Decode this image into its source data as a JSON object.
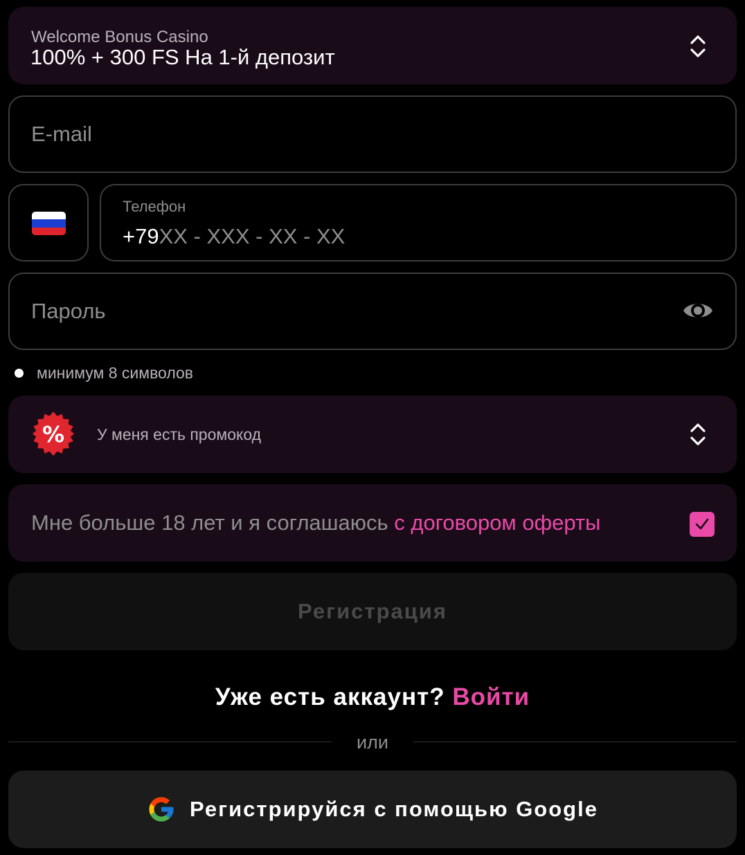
{
  "bonus": {
    "label": "Welcome Bonus Casino",
    "value": "100% + 300 FS На 1-й депозит"
  },
  "email": {
    "placeholder": "E-mail"
  },
  "phone": {
    "country_flag": "russia-flag",
    "flag_colors": [
      "#ffffff",
      "#1c3fd1",
      "#e0242e"
    ],
    "label": "Телефон",
    "prefix": "+79",
    "mask": "XX - XXX - XX - XX"
  },
  "password": {
    "placeholder": "Пароль",
    "toggle_icon": "eye-icon"
  },
  "password_hint": "минимум 8 символов",
  "promo": {
    "icon": "percent-badge-icon",
    "label": "У меня есть промокод"
  },
  "agreement": {
    "text": "Мне больше 18 лет и я соглашаюсь ",
    "link": "с договором оферты",
    "checked": true
  },
  "register_label": "Регистрация",
  "account": {
    "text": "Уже есть аккаунт? ",
    "login_link": "Войти"
  },
  "divider": "или",
  "google": {
    "icon": "google-icon",
    "label": "Регистрируйся с помощью Google"
  },
  "colors": {
    "background": "#000000",
    "panel": "#1a0b19",
    "accent": "#e94aa7",
    "muted_text": "#8e8e8e",
    "border": "#3d3d3d",
    "disabled_button": "#111111",
    "google_button": "#1c1c1c"
  }
}
